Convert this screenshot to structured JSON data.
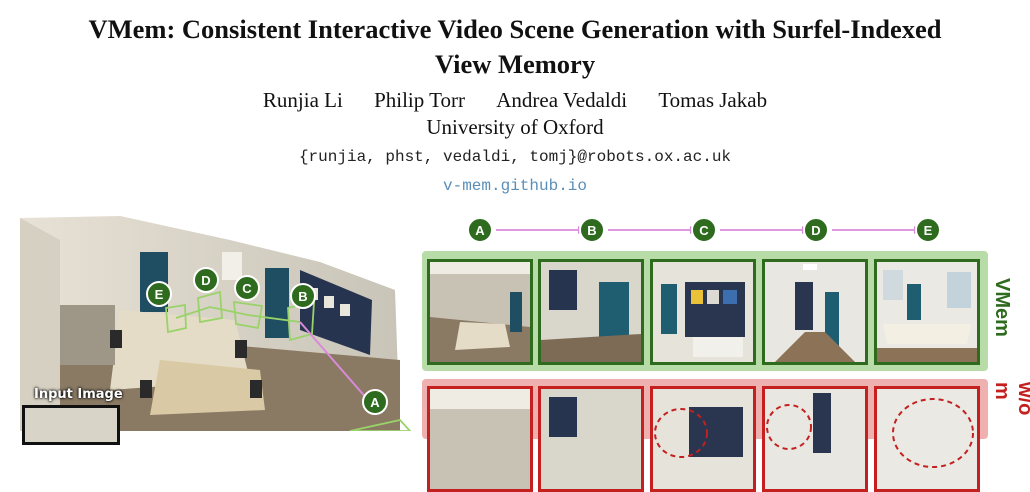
{
  "paper": {
    "title_line1": "VMem: Consistent Interactive Video Scene Generation with Surfel-Indexed",
    "title_line2": "View Memory",
    "authors": [
      "Runjia Li",
      "Philip Torr",
      "Andrea Vedaldi",
      "Tomas Jakab"
    ],
    "affiliation": "University of Oxford",
    "email": "{runjia, phst, vedaldi, tomj}@robots.ox.ac.uk",
    "website": "v-mem.github.io"
  },
  "figure": {
    "input_label": "Input Image",
    "trajectory_nodes": [
      "A",
      "B",
      "C",
      "D",
      "E"
    ],
    "scene_nodes": [
      "E",
      "D",
      "C",
      "B",
      "A"
    ],
    "row_labels": {
      "vmem": "VMem",
      "without": "w/o m"
    },
    "colors": {
      "vmem_green": "#2e6b1e",
      "vmem_bg": "#b8dca8",
      "without_red": "#c42020",
      "without_bg": "#efb0b0",
      "arrow_pink": "#d98ad9"
    }
  }
}
